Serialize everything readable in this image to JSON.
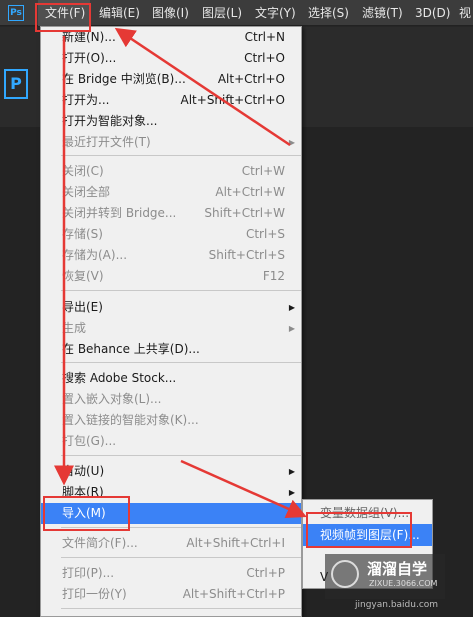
{
  "app": {
    "logo": "Ps",
    "canvas_logo": "P"
  },
  "menubar": {
    "items": [
      "文件(F)",
      "编辑(E)",
      "图像(I)",
      "图层(L)",
      "文字(Y)",
      "选择(S)",
      "滤镜(T)",
      "3D(D)",
      "视"
    ]
  },
  "file_menu": {
    "items": [
      {
        "label": "新建(N)...",
        "shortcut": "Ctrl+N",
        "state": "enabled"
      },
      {
        "label": "打开(O)...",
        "shortcut": "Ctrl+O",
        "state": "enabled"
      },
      {
        "label": "在 Bridge 中浏览(B)...",
        "shortcut": "Alt+Ctrl+O",
        "state": "enabled"
      },
      {
        "label": "打开为...",
        "shortcut": "Alt+Shift+Ctrl+O",
        "state": "enabled"
      },
      {
        "label": "打开为智能对象...",
        "shortcut": "",
        "state": "enabled"
      },
      {
        "label": "最近打开文件(T)",
        "shortcut": "",
        "state": "disabled",
        "submenu": true
      },
      {
        "label": "关闭(C)",
        "shortcut": "Ctrl+W",
        "state": "disabled"
      },
      {
        "label": "关闭全部",
        "shortcut": "Alt+Ctrl+W",
        "state": "disabled"
      },
      {
        "label": "关闭并转到 Bridge...",
        "shortcut": "Shift+Ctrl+W",
        "state": "disabled"
      },
      {
        "label": "存储(S)",
        "shortcut": "Ctrl+S",
        "state": "disabled"
      },
      {
        "label": "存储为(A)...",
        "shortcut": "Shift+Ctrl+S",
        "state": "disabled"
      },
      {
        "label": "恢复(V)",
        "shortcut": "F12",
        "state": "disabled"
      },
      {
        "label": "导出(E)",
        "shortcut": "",
        "state": "enabled",
        "submenu": true
      },
      {
        "label": "生成",
        "shortcut": "",
        "state": "disabled",
        "submenu": true
      },
      {
        "label": "在 Behance 上共享(D)...",
        "shortcut": "",
        "state": "enabled"
      },
      {
        "label": "搜索 Adobe Stock...",
        "shortcut": "",
        "state": "enabled"
      },
      {
        "label": "置入嵌入对象(L)...",
        "shortcut": "",
        "state": "disabled"
      },
      {
        "label": "置入链接的智能对象(K)...",
        "shortcut": "",
        "state": "disabled"
      },
      {
        "label": "打包(G)...",
        "shortcut": "",
        "state": "disabled"
      },
      {
        "label": "自动(U)",
        "shortcut": "",
        "state": "enabled",
        "submenu": true
      },
      {
        "label": "脚本(R)",
        "shortcut": "",
        "state": "enabled",
        "submenu": true
      },
      {
        "label": "导入(M)",
        "shortcut": "",
        "state": "highlighted",
        "submenu": true
      },
      {
        "label": "文件简介(F)...",
        "shortcut": "Alt+Shift+Ctrl+I",
        "state": "disabled"
      },
      {
        "label": "打印(P)...",
        "shortcut": "Ctrl+P",
        "state": "disabled"
      },
      {
        "label": "打印一份(Y)",
        "shortcut": "Alt+Shift+Ctrl+P",
        "state": "disabled"
      }
    ]
  },
  "import_submenu": {
    "items": [
      {
        "label": "变量数据组(V)...",
        "state": "dim"
      },
      {
        "label": "视频帧到图层(F)...",
        "state": "highlighted"
      },
      {
        "label": "",
        "state": "enabled"
      },
      {
        "label": "V",
        "state": "enabled"
      }
    ]
  },
  "watermark": {
    "title": "溜溜自学",
    "subtitle": "ZIXUE.3066.COM",
    "bottom": "jingyan.baidu.com"
  },
  "colors": {
    "highlight": "#3b82f6",
    "annotation": "#e53935",
    "ps_blue": "#31a8ff"
  }
}
